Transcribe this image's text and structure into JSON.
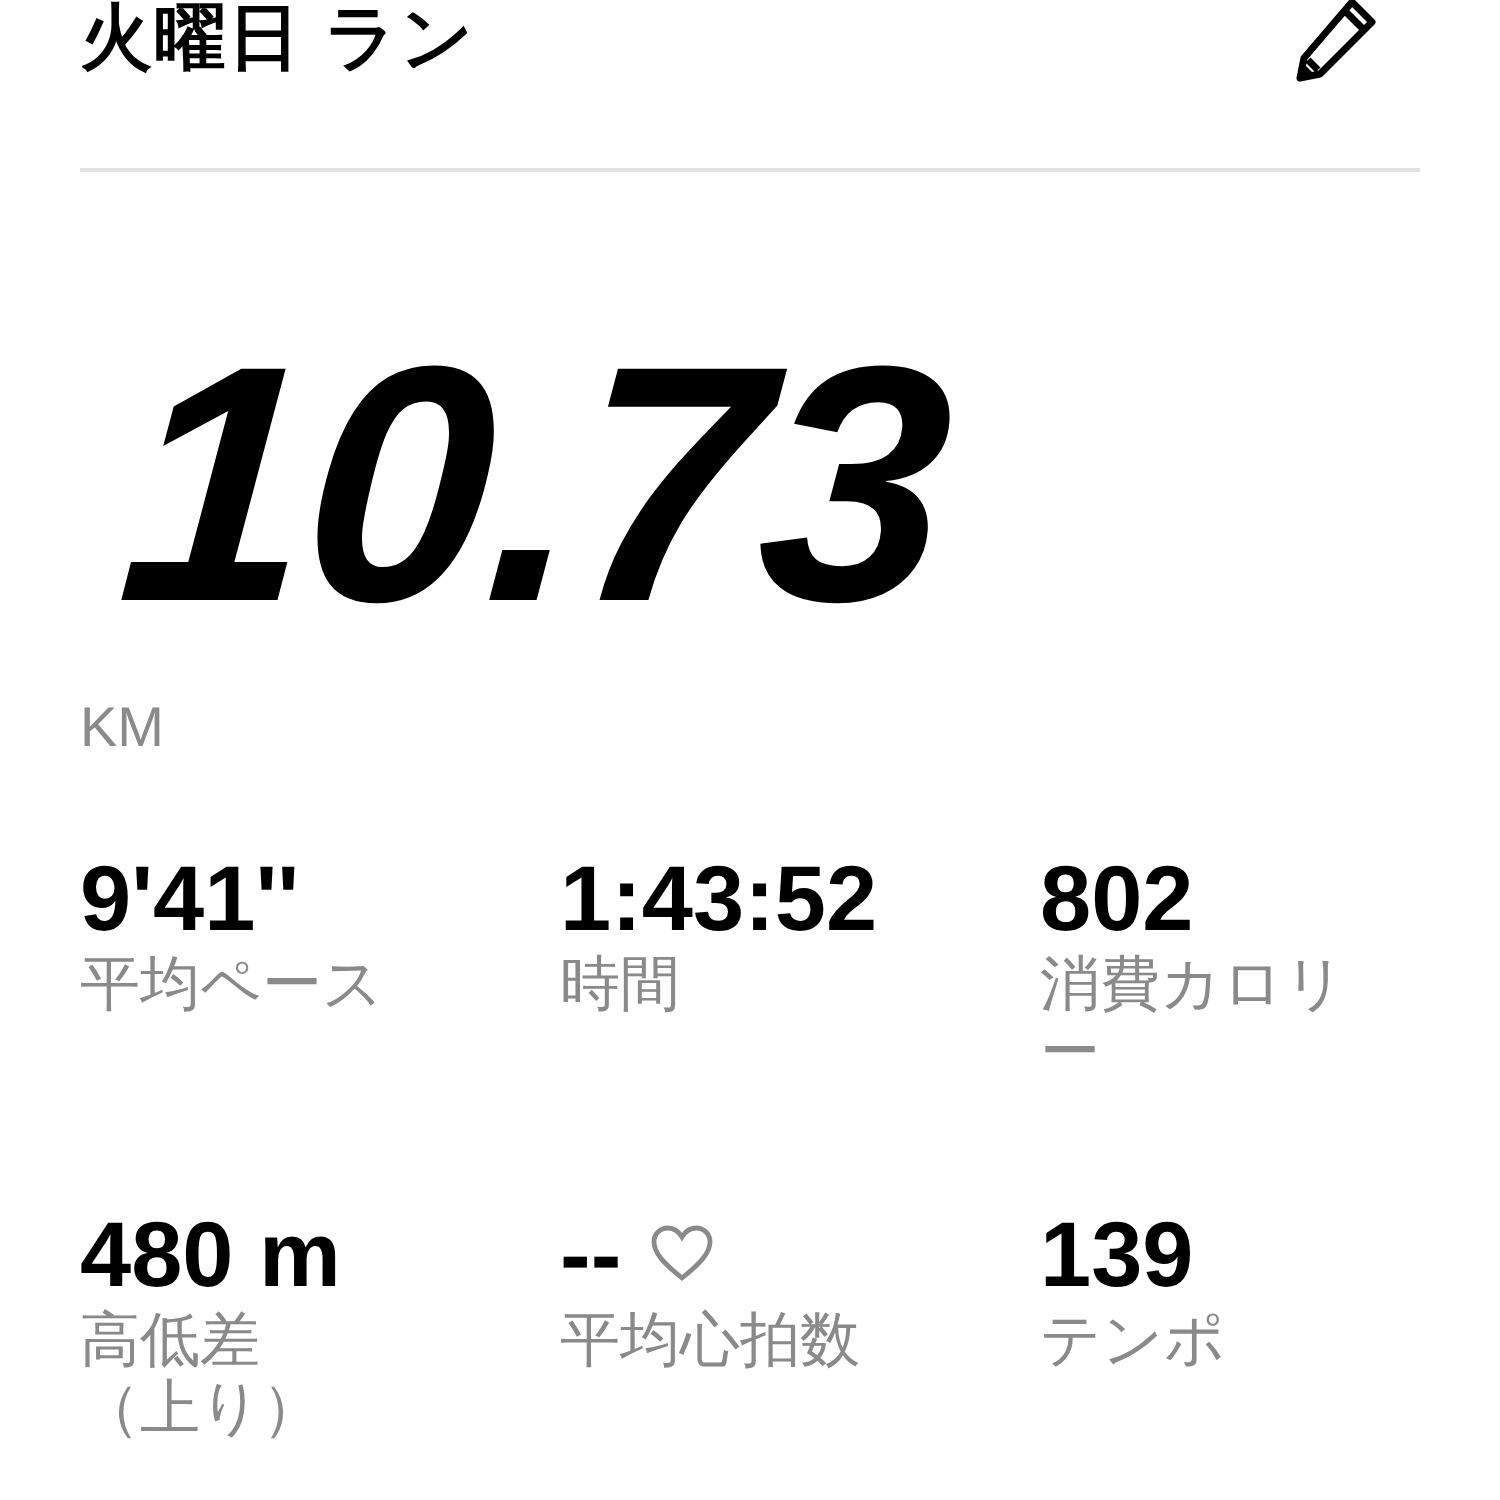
{
  "header": {
    "title": "火曜日 ラン"
  },
  "distance": {
    "value": "10.73",
    "unit": "KM"
  },
  "stats": [
    {
      "value": "9'41''",
      "label": "平均ペース",
      "kind": "plain"
    },
    {
      "value": "1:43:52",
      "label": "時間",
      "kind": "plain"
    },
    {
      "value": "802",
      "label": "消費カロリー",
      "kind": "plain"
    },
    {
      "value": "480 m",
      "label": "高低差（上り）",
      "kind": "plain"
    },
    {
      "value": "--",
      "label": "平均心拍数",
      "kind": "heart"
    },
    {
      "value": "139",
      "label": "テンポ",
      "kind": "plain"
    }
  ]
}
